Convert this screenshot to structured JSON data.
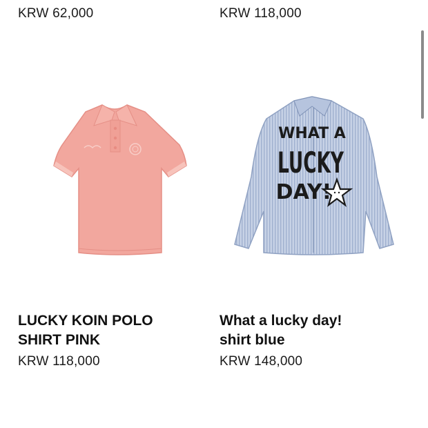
{
  "top_row": {
    "left_price": "KRW 62,000",
    "right_price": "KRW 118,000"
  },
  "products": [
    {
      "name_line1": "LUCKY KOIN POLO",
      "name_line2": "SHIRT PINK",
      "price": "KRW 118,000",
      "image_icon": "pink-polo-shirt",
      "color": "#f2a79e"
    },
    {
      "name_line1": "What a lucky day!",
      "name_line2": "shirt blue",
      "price": "KRW 148,000",
      "image_icon": "blue-striped-shirt",
      "color": "#b9c6dc",
      "print": {
        "line1": "WHAT A",
        "line2": "LUCKY",
        "line3": "DAY!"
      }
    }
  ]
}
